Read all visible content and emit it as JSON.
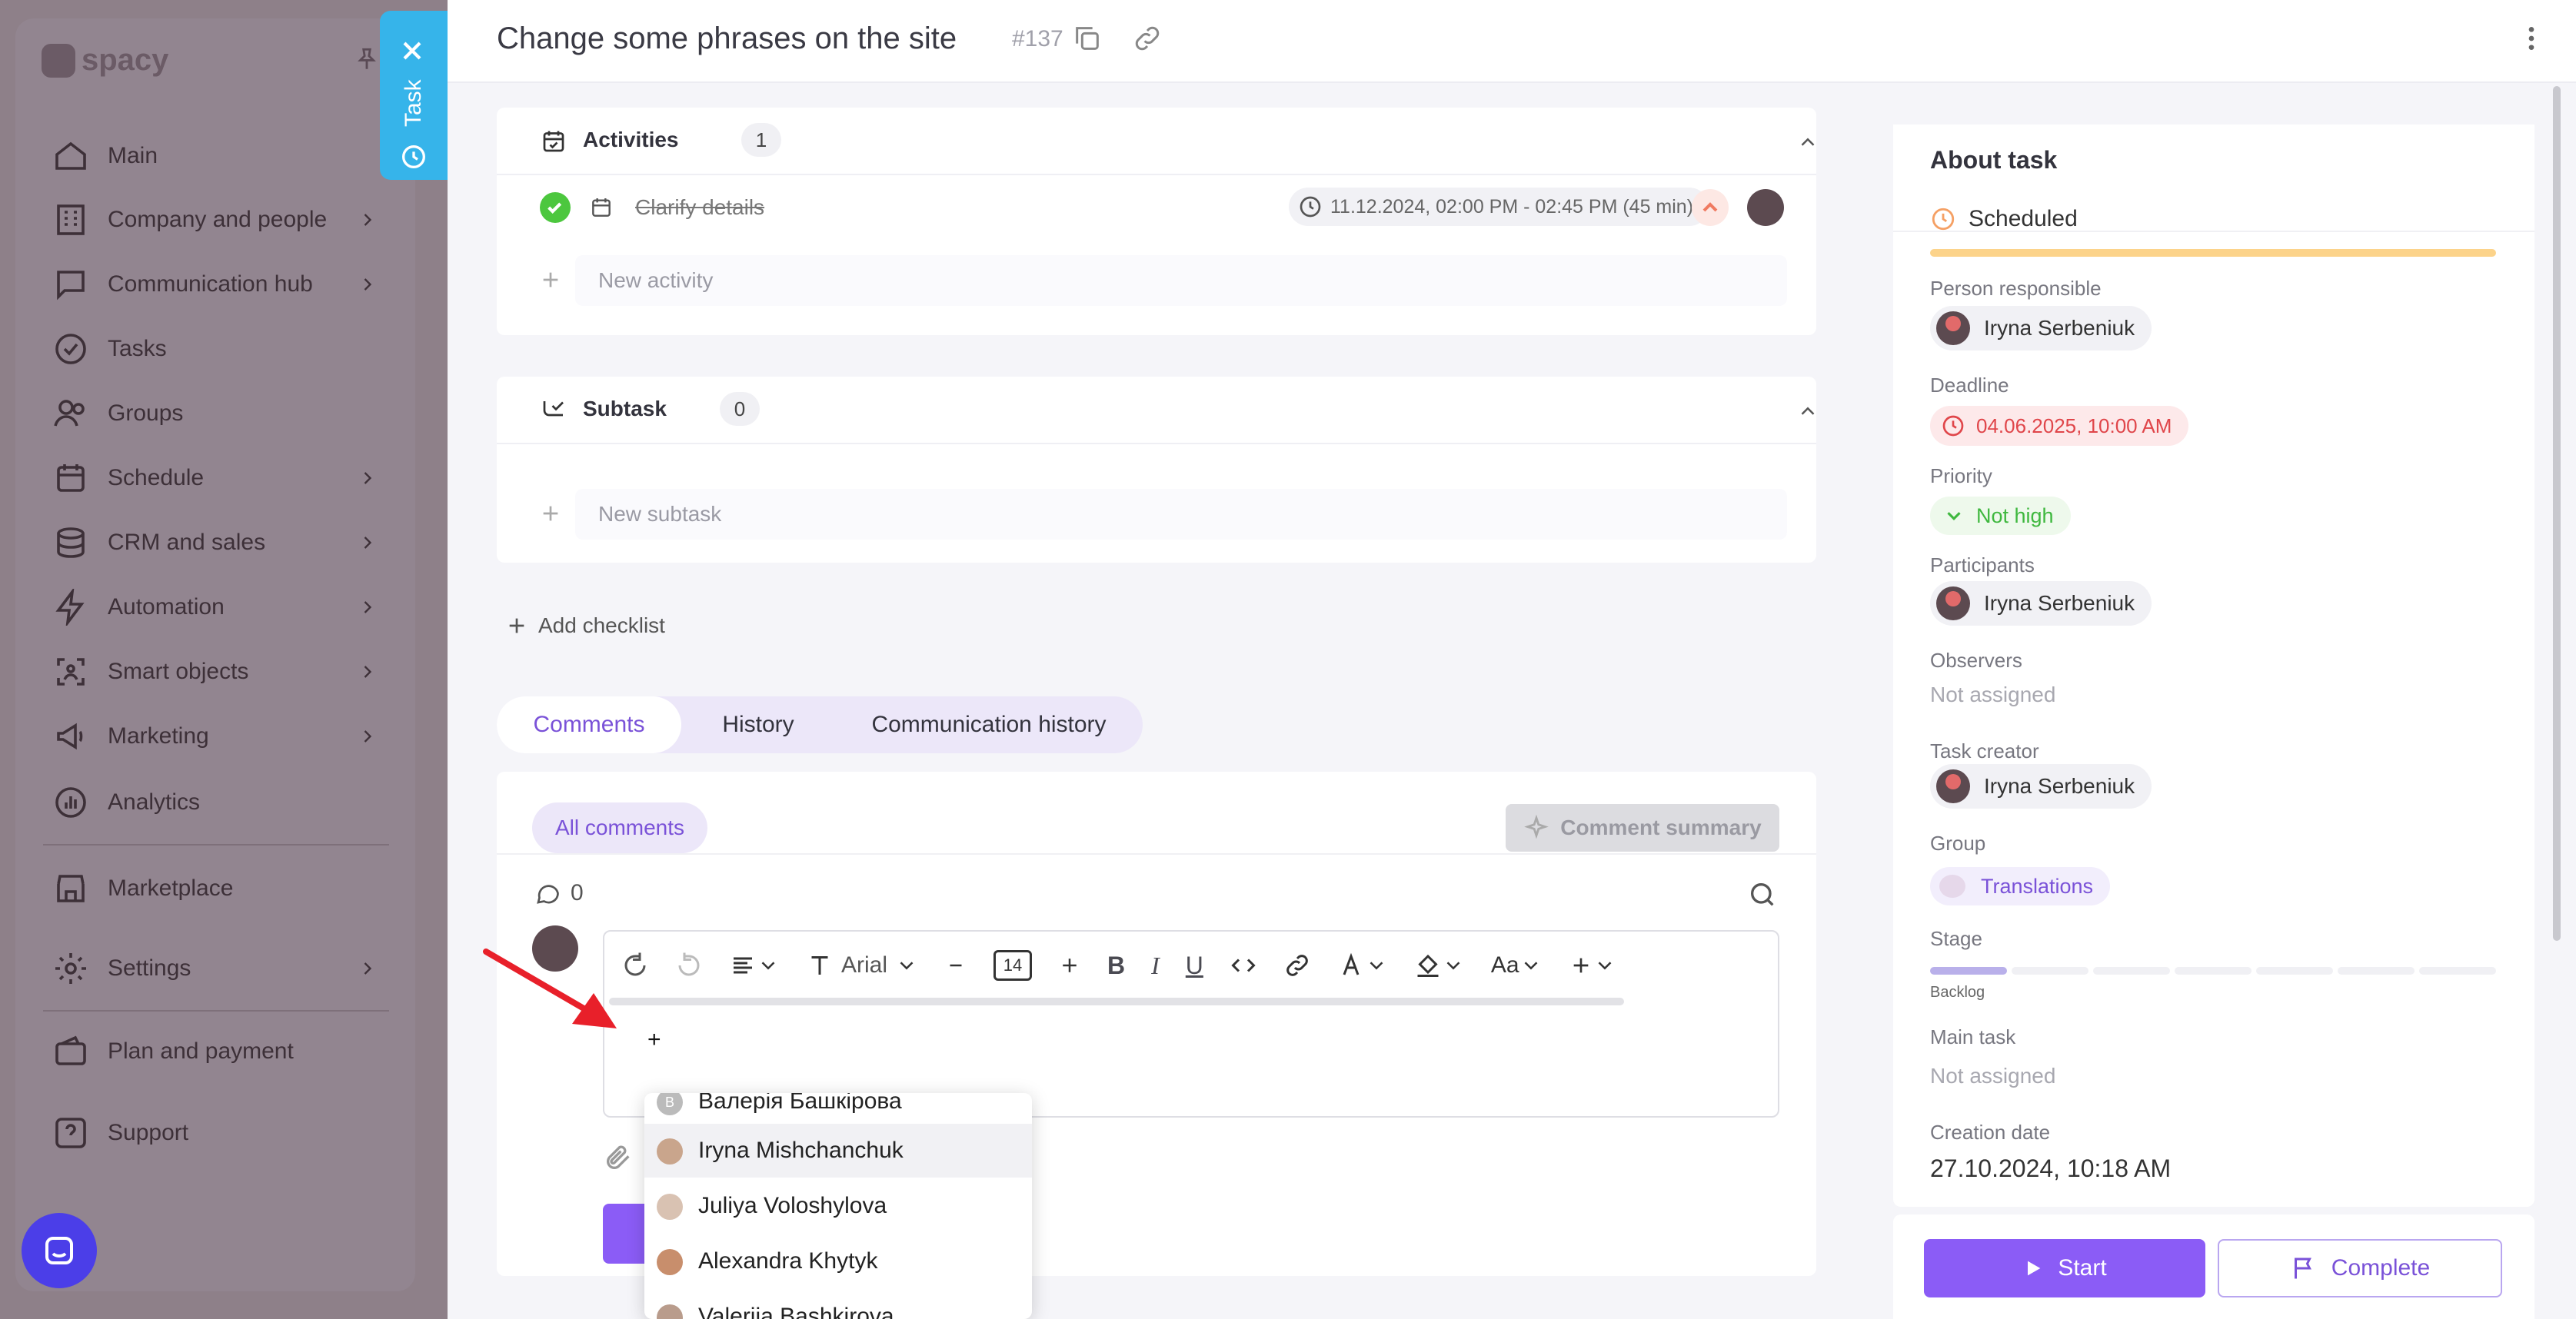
{
  "sidebar": {
    "logo": "spacy",
    "items": [
      {
        "label": "Main",
        "icon": "home-icon",
        "has_chevron": false
      },
      {
        "label": "Company and people",
        "icon": "building-icon",
        "has_chevron": true
      },
      {
        "label": "Communication hub",
        "icon": "chat-icon",
        "has_chevron": true
      },
      {
        "label": "Tasks",
        "icon": "check-circle-icon",
        "has_chevron": false
      },
      {
        "label": "Groups",
        "icon": "users-icon",
        "has_chevron": false
      },
      {
        "label": "Schedule",
        "icon": "calendar-icon",
        "has_chevron": true
      },
      {
        "label": "CRM and sales",
        "icon": "database-icon",
        "has_chevron": true
      },
      {
        "label": "Automation",
        "icon": "lightning-icon",
        "has_chevron": true
      },
      {
        "label": "Smart objects",
        "icon": "scan-icon",
        "has_chevron": true
      },
      {
        "label": "Marketing",
        "icon": "megaphone-icon",
        "has_chevron": true
      },
      {
        "label": "Analytics",
        "icon": "chart-icon",
        "has_chevron": false
      },
      {
        "label": "Marketplace",
        "icon": "store-icon",
        "has_chevron": false
      },
      {
        "label": "Settings",
        "icon": "gear-icon",
        "has_chevron": true
      },
      {
        "label": "Plan and payment",
        "icon": "wallet-icon",
        "has_chevron": false
      },
      {
        "label": "Support",
        "icon": "help-icon",
        "has_chevron": false
      }
    ]
  },
  "task_tab": {
    "label": "Task"
  },
  "header": {
    "title": "Change some phrases on the site",
    "task_id": "#137"
  },
  "activities": {
    "title": "Activities",
    "count": "1",
    "item": {
      "label": "Clarify details",
      "time": "11.12.2024, 02:00 PM - 02:45 PM (45 min)"
    },
    "new_placeholder": "New activity"
  },
  "subtask": {
    "title": "Subtask",
    "count": "0",
    "new_placeholder": "New subtask"
  },
  "add_checklist": "Add checklist",
  "tabs": {
    "comments": "Comments",
    "history": "History",
    "communication_history": "Communication history"
  },
  "comments": {
    "filter": "All comments",
    "summary_button": "Comment summary",
    "count": "0",
    "editor_text": "+"
  },
  "toolbar": {
    "font_name": "Arial",
    "font_size": "14",
    "text_style": "Aa"
  },
  "mentions": [
    {
      "name": "Валерія Башкірова",
      "initial": "В"
    },
    {
      "name": "Iryna Mishchanchuk"
    },
    {
      "name": "Juliya Voloshylova"
    },
    {
      "name": "Alexandra Khytyk"
    },
    {
      "name": "Valeriia Bashkirova"
    }
  ],
  "about": {
    "title": "About task",
    "status": "Scheduled",
    "person_responsible_label": "Person responsible",
    "person_responsible": "Iryna Serbeniuk",
    "deadline_label": "Deadline",
    "deadline": "04.06.2025, 10:00 AM",
    "priority_label": "Priority",
    "priority": "Not high",
    "participants_label": "Participants",
    "participant": "Iryna Serbeniuk",
    "observers_label": "Observers",
    "observers": "Not assigned",
    "task_creator_label": "Task creator",
    "task_creator": "Iryna Serbeniuk",
    "group_label": "Group",
    "group": "Translations",
    "stage_label": "Stage",
    "stage": "Backlog",
    "main_task_label": "Main task",
    "main_task": "Not assigned",
    "creation_date_label": "Creation date",
    "creation_date": "27.10.2024, 10:18 AM"
  },
  "footer": {
    "start": "Start",
    "complete": "Complete"
  },
  "colors": {
    "accent": "#8b5cf6",
    "task_tab": "#36b4ea",
    "deadline_red": "#e0464a",
    "priority_green": "#3fb83f",
    "status_orange": "#f5a623"
  }
}
